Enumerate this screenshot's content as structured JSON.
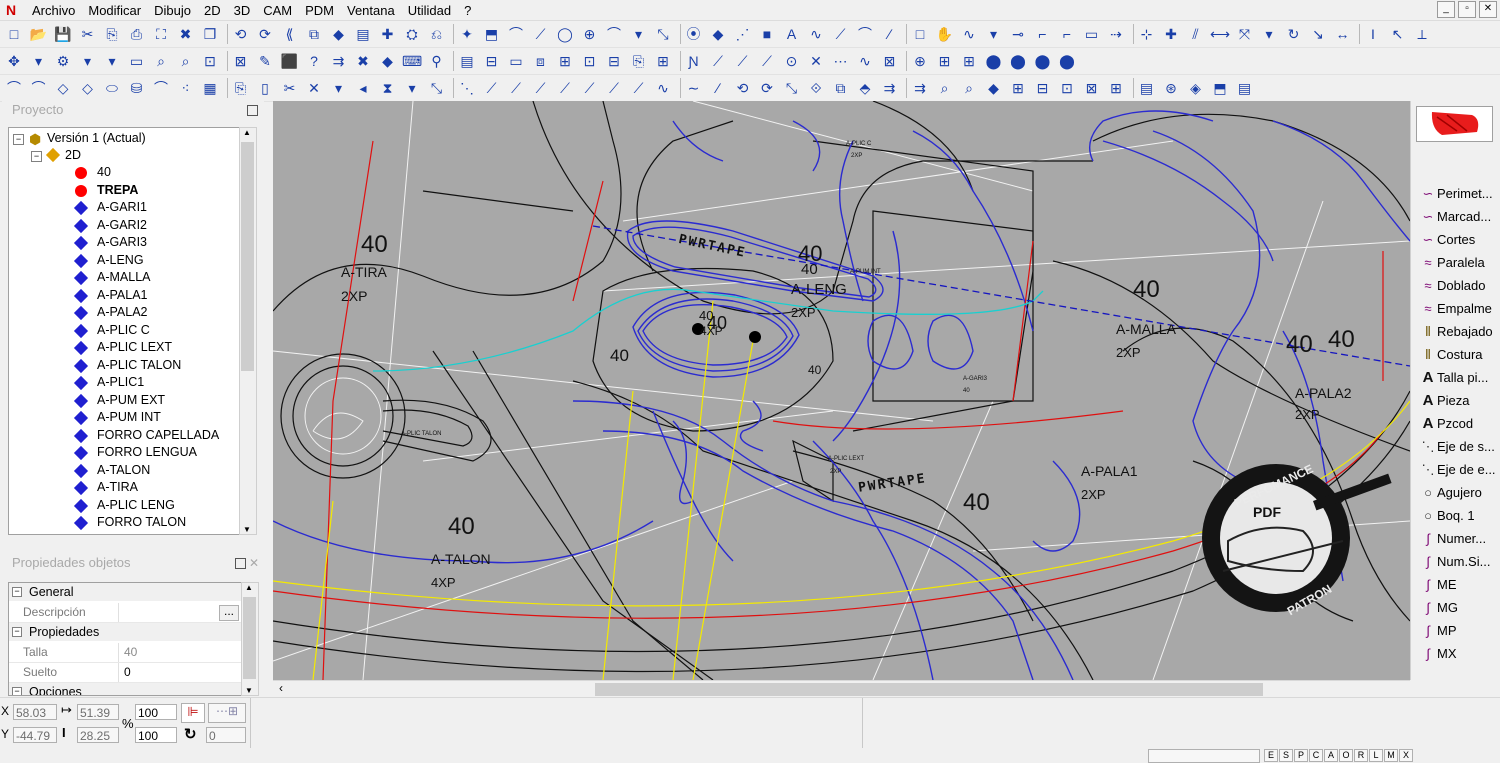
{
  "menu": {
    "items": [
      "Archivo",
      "Modificar",
      "Dibujo",
      "2D",
      "3D",
      "CAM",
      "PDM",
      "Ventana",
      "Utilidad",
      "?"
    ]
  },
  "window_controls": [
    "_",
    "▫",
    "✕"
  ],
  "project_panel": {
    "title": "Proyecto",
    "root": "Versión 1 (Actual)",
    "node": "2D",
    "items": [
      {
        "label": "40",
        "marker": "red-dot",
        "bold": false
      },
      {
        "label": "TREPA",
        "marker": "red-dot",
        "bold": true
      },
      {
        "label": "A-GARI1",
        "marker": "blue-diamond",
        "bold": false
      },
      {
        "label": "A-GARI2",
        "marker": "blue-diamond",
        "bold": false
      },
      {
        "label": "A-GARI3",
        "marker": "blue-diamond",
        "bold": false
      },
      {
        "label": "A-LENG",
        "marker": "blue-diamond",
        "bold": false
      },
      {
        "label": "A-MALLA",
        "marker": "blue-diamond",
        "bold": false
      },
      {
        "label": "A-PALA1",
        "marker": "blue-diamond",
        "bold": false
      },
      {
        "label": "A-PALA2",
        "marker": "blue-diamond",
        "bold": false
      },
      {
        "label": "A-PLIC C",
        "marker": "blue-diamond",
        "bold": false
      },
      {
        "label": "A-PLIC LEXT",
        "marker": "blue-diamond",
        "bold": false
      },
      {
        "label": "A-PLIC TALON",
        "marker": "blue-diamond",
        "bold": false
      },
      {
        "label": "A-PLIC1",
        "marker": "blue-diamond",
        "bold": false
      },
      {
        "label": "A-PUM EXT",
        "marker": "blue-diamond",
        "bold": false
      },
      {
        "label": "A-PUM INT",
        "marker": "blue-diamond",
        "bold": false
      },
      {
        "label": "FORRO CAPELLADA",
        "marker": "blue-diamond",
        "bold": false
      },
      {
        "label": "FORRO LENGUA",
        "marker": "blue-diamond",
        "bold": false
      },
      {
        "label": "A-TALON",
        "marker": "blue-diamond",
        "bold": false
      },
      {
        "label": "A-TIRA",
        "marker": "blue-diamond",
        "bold": false
      },
      {
        "label": "A-PLIC LENG",
        "marker": "blue-diamond",
        "bold": false
      },
      {
        "label": "FORRO TALON",
        "marker": "blue-diamond",
        "bold": false
      }
    ]
  },
  "properties_panel": {
    "title": "Propiedades objetos",
    "sections": [
      {
        "name": "General",
        "rows": [
          {
            "key": "Descripción",
            "value": "",
            "button": "..."
          }
        ]
      },
      {
        "name": "Propiedades",
        "rows": [
          {
            "key": "Talla",
            "value": "40"
          },
          {
            "key": "Suelto",
            "value": "0"
          }
        ]
      },
      {
        "name": "Opciones",
        "rows": []
      }
    ]
  },
  "canvas": {
    "labels": [
      {
        "text": "40"
      },
      {
        "text": "A-TIRA"
      },
      {
        "text": "2XP"
      },
      {
        "text": "PWRTAPE"
      },
      {
        "text": "40"
      },
      {
        "text": "40"
      },
      {
        "text": "A-LENG"
      },
      {
        "text": "2XP"
      },
      {
        "text": "40"
      },
      {
        "text": "A-MALLA"
      },
      {
        "text": "2XP"
      },
      {
        "text": "40"
      },
      {
        "text": "40"
      },
      {
        "text": "A-PALA2"
      },
      {
        "text": "2XP"
      },
      {
        "text": "40"
      },
      {
        "text": "40"
      },
      {
        "text": "4XP"
      },
      {
        "text": "40"
      },
      {
        "text": "PWRTAPE"
      },
      {
        "text": "40"
      },
      {
        "text": "A-PALA1"
      },
      {
        "text": "2XP"
      },
      {
        "text": "40"
      },
      {
        "text": "A-TALON"
      },
      {
        "text": "4XP"
      },
      {
        "text": "40"
      }
    ],
    "small_labels": [
      "A-PLIC C",
      "2XP",
      "A-PLIC LEXT",
      "2XP",
      "A-GARI3",
      "40",
      "A-PLIC TALON",
      "A-PUM INT"
    ],
    "watermark": {
      "top": "PERFOMANCE",
      "center": "PDF",
      "bottom": "PATRON"
    }
  },
  "right_panel": {
    "items": [
      {
        "label": "Perimet...",
        "icon": "curve-icon"
      },
      {
        "label": "Marcad...",
        "icon": "curve-icon"
      },
      {
        "label": "Cortes",
        "icon": "curve-icon"
      },
      {
        "label": "Paralela",
        "icon": "parallel-icon"
      },
      {
        "label": "Doblado",
        "icon": "fold-icon"
      },
      {
        "label": "Empalme",
        "icon": "join-icon"
      },
      {
        "label": "Rebajado",
        "icon": "skive-icon"
      },
      {
        "label": "Costura",
        "icon": "seam-icon"
      },
      {
        "label": "Talla pi...",
        "icon": "text-icon"
      },
      {
        "label": "Pieza",
        "icon": "text-icon"
      },
      {
        "label": "Pzcod",
        "icon": "text-icon"
      },
      {
        "label": "Eje de s...",
        "icon": "axis-icon"
      },
      {
        "label": "Eje de e...",
        "icon": "axis-icon"
      },
      {
        "label": "Agujero",
        "icon": "circle-icon"
      },
      {
        "label": "Boq. 1",
        "icon": "circle-icon"
      },
      {
        "label": "Numer...",
        "icon": "pen-icon"
      },
      {
        "label": "Num.Si...",
        "icon": "pen-icon"
      },
      {
        "label": "ME",
        "icon": "pen-icon"
      },
      {
        "label": "MG",
        "icon": "pen-icon"
      },
      {
        "label": "MP",
        "icon": "pen-icon"
      },
      {
        "label": "MX",
        "icon": "pen-icon"
      }
    ]
  },
  "status": {
    "x_label": "X",
    "y_label": "Y",
    "x_value": "58.03",
    "y_value": "-44.79",
    "dx_value": "51.39",
    "dy_value": "28.25",
    "percent_label": "%",
    "zoom1": "100",
    "zoom2": "100",
    "rot_value": "0",
    "snap_letters": [
      "E",
      "S",
      "P",
      "C",
      "A",
      "O",
      "R",
      "L",
      "M",
      "X"
    ]
  }
}
